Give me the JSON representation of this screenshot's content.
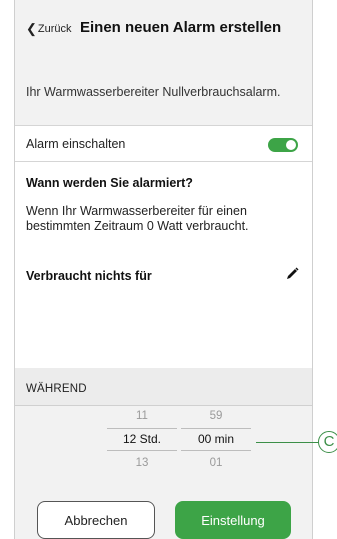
{
  "header": {
    "back_label": "Zurück",
    "title": "Einen neuen Alarm erstellen",
    "subtitle": "Ihr Warmwasserbereiter Nullverbrauchsalarm."
  },
  "alarm_toggle": {
    "label": "Alarm einschalten",
    "state": "on",
    "color": "#3da447"
  },
  "notify": {
    "heading": "Wann werden Sie alarmiert?",
    "description": "Wenn Ihr Warmwasserbereiter für einen bestimmten Zeitraum 0 Watt verbraucht.",
    "consumes_label": "Verbraucht nichts für",
    "edit_icon": "pencil-icon"
  },
  "duration": {
    "label": "WÄHREND",
    "hours": {
      "above": "11",
      "selected": "12 Std.",
      "below": "13"
    },
    "minutes": {
      "above": "59",
      "selected": "00 min",
      "below": "01"
    }
  },
  "buttons": {
    "cancel": "Abbrechen",
    "confirm": "Einstellung"
  },
  "callout": {
    "letter": "C"
  }
}
